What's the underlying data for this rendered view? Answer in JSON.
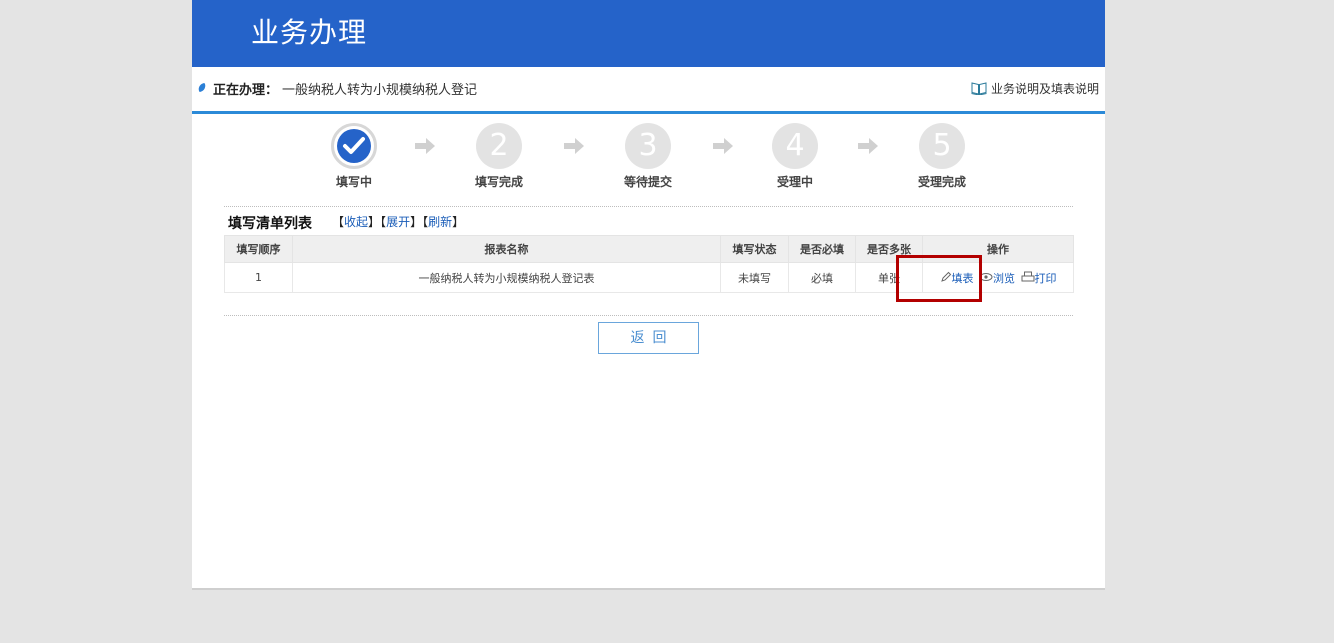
{
  "header": {
    "title": "业务办理"
  },
  "current": {
    "label": "正在办理：",
    "value": "一般纳税人转为小规模纳税人登记"
  },
  "help": {
    "label": "业务说明及填表说明",
    "icon": "book-icon"
  },
  "steps": [
    {
      "label": "填写中",
      "number": "",
      "state": "active"
    },
    {
      "label": "填写完成",
      "number": "2",
      "state": "pending"
    },
    {
      "label": "等待提交",
      "number": "3",
      "state": "pending"
    },
    {
      "label": "受理中",
      "number": "4",
      "state": "pending"
    },
    {
      "label": "受理完成",
      "number": "5",
      "state": "pending"
    }
  ],
  "list": {
    "title": "填写清单列表",
    "collapse": "收起",
    "expand": "展开",
    "refresh": "刷新",
    "bracket_open": "【",
    "bracket_close": "】",
    "columns": [
      "填写顺序",
      "报表名称",
      "填写状态",
      "是否必填",
      "是否多张",
      "操作"
    ],
    "rows": [
      {
        "order": "1",
        "name": "一般纳税人转为小规模纳税人登记表",
        "status": "未填写",
        "required": "必填",
        "multiple": "单张",
        "ops": {
          "fill": "填表",
          "browse": "浏览",
          "print": "打印"
        }
      }
    ]
  },
  "buttons": {
    "back": "返回"
  },
  "colors": {
    "header": "#2563c9",
    "accent": "#2b8ad8",
    "link": "#1a5db8",
    "highlight": "#b30000"
  }
}
